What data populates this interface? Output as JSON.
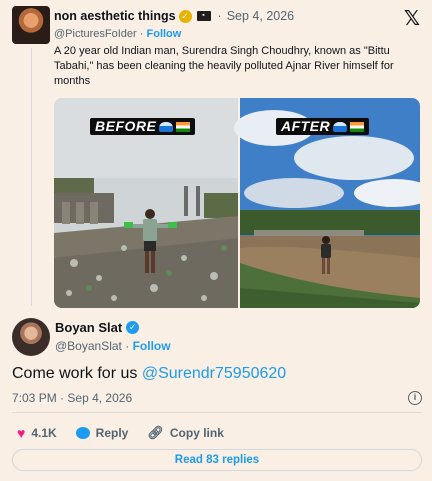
{
  "quoted": {
    "name": "non aesthetic things",
    "date": "Sep 4, 2026",
    "handle": "@PicturesFoIder",
    "follow_label": "Follow",
    "text": "A 20 year old Indian man, Surendra Singh Choudhry, known as \"Bittu Tabahi,\" has been cleaning the heavily polluted Ajnar River himself for months",
    "media": {
      "before_label": "BEFORE",
      "after_label": "AFTER"
    }
  },
  "main": {
    "name": "Boyan Slat",
    "handle": "@BoyanSlat",
    "follow_label": "Follow",
    "text": "Come work for us",
    "mention": "@Surendr75950620",
    "time": "7:03 PM",
    "date": "Sep 4, 2026",
    "likes": "4.1K",
    "reply_label": "Reply",
    "copy_label": "Copy link",
    "read_replies": "Read 83 replies"
  },
  "icons": {
    "logo": "x-logo",
    "verified_quoted": "gold-verified-badge",
    "verified_main": "blue-verified-badge",
    "like": "heart-icon",
    "reply": "reply-bubble-icon",
    "copy": "link-icon",
    "info": "info-icon"
  },
  "colors": {
    "background": "#f9efe4",
    "accent": "#1d9bf0",
    "heart": "#f91880",
    "muted": "#536471"
  }
}
